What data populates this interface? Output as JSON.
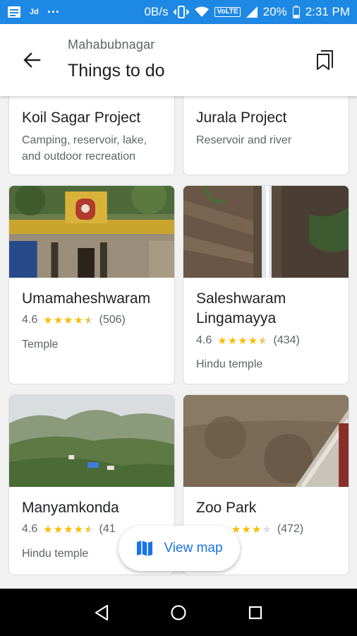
{
  "status_bar": {
    "carrier": "Jd",
    "dots": "···",
    "net_speed": "0B/s",
    "volte": "VoLTE",
    "battery": "20%",
    "time": "2:31 PM"
  },
  "header": {
    "subtitle": "Mahabubnagar",
    "title": "Things to do"
  },
  "cards": [
    {
      "name": "Koil Sagar Project",
      "desc_line1": "Camping, reservoir, lake,",
      "desc_line2": "and outdoor recreation"
    },
    {
      "name": "Jurala Project",
      "desc_line1": "Reservoir and river"
    },
    {
      "name": "Umamaheshwaram",
      "rating": "4.6",
      "stars": 4.5,
      "reviews": "(506)",
      "type": "Temple"
    },
    {
      "name_line1": "Saleshwaram",
      "name_line2": "Lingamayya",
      "rating": "4.6",
      "stars": 4.5,
      "reviews": "(434)",
      "type": "Hindu temple"
    },
    {
      "name": "Manyamkonda",
      "rating": "4.6",
      "stars": 4.5,
      "reviews": "(41",
      "type": "Hindu temple"
    },
    {
      "name": "Zoo Park",
      "stars": 3,
      "reviews": "(472)"
    }
  ],
  "fab": {
    "label": "View map"
  },
  "colors": {
    "accent": "#1a73e8",
    "status_bar": "#1e88e5",
    "star": "#fbbc04"
  },
  "icons": {
    "back": "arrow-back-icon",
    "bookmark": "bookmark-icon",
    "map": "map-icon",
    "nav_back": "triangle-back-icon",
    "nav_home": "circle-home-icon",
    "nav_recents": "square-recents-icon"
  }
}
